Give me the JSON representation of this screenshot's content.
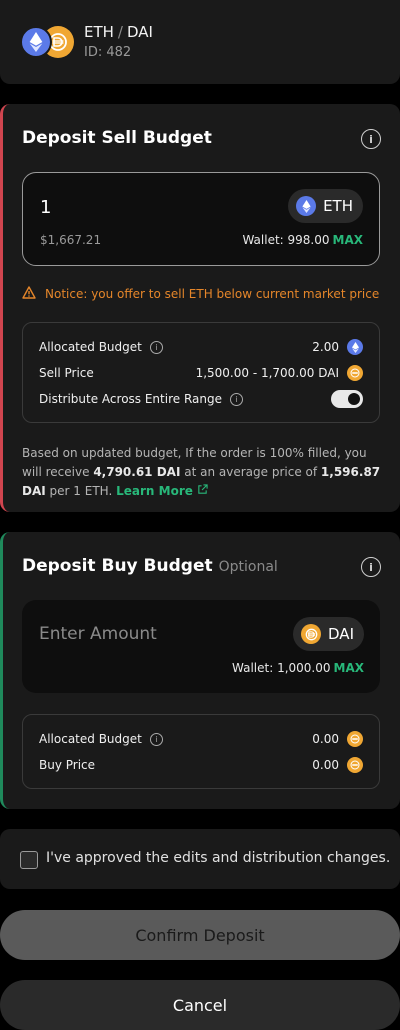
{
  "pair": {
    "base": "ETH",
    "separator": "/",
    "quote": "DAI",
    "id": "ID: 482"
  },
  "sell": {
    "title": "Deposit Sell Budget",
    "amount": "1",
    "token": "ETH",
    "fiat": "$1,667.21",
    "wallet": "Wallet: 998.00",
    "max": "MAX",
    "notice": "Notice: you offer to sell ETH below current market price",
    "allocated_label": "Allocated Budget",
    "allocated_value": "2.00",
    "price_label": "Sell Price",
    "price_value": "1,500.00 - 1,700.00 DAI",
    "distribute_label": "Distribute Across Entire Range",
    "distribute_on": true,
    "summary": {
      "p1": "Based on updated budget, If the order is 100% filled, you will receive",
      "receive": "4,790.61 DAI",
      "p2": "at an average price of",
      "avg": "1,596.87 DAI",
      "p3": "per 1 ETH.",
      "learn": "Learn More"
    }
  },
  "buy": {
    "title": "Deposit Buy Budget",
    "optional": "Optional",
    "placeholder": "Enter Amount",
    "token": "DAI",
    "wallet": "Wallet: 1,000.00",
    "max": "MAX",
    "allocated_label": "Allocated Budget",
    "allocated_value": "0.00",
    "price_label": "Buy Price",
    "price_value": "0.00"
  },
  "approve": {
    "text": "I've approved the edits and distribution changes.",
    "checked": false
  },
  "buttons": {
    "confirm": "Confirm Deposit",
    "cancel": "Cancel"
  },
  "colors": {
    "sell_accent": "#d0454f",
    "buy_accent": "#1f8a5c",
    "max": "#28b87a",
    "notice": "#e5862a",
    "eth": "#5b7ae8",
    "dai": "#f0a733"
  },
  "icons": {
    "eth": "ethereum-icon",
    "dai": "dai-icon",
    "info": "info-icon",
    "warning": "warning-icon",
    "external": "external-link-icon"
  }
}
